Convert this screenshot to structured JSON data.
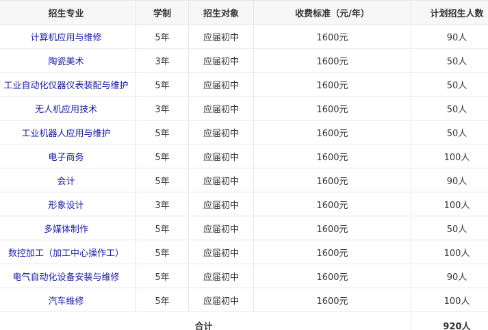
{
  "table": {
    "headers": {
      "major": "招生专业",
      "years": "学制",
      "target": "招生对象",
      "fee": "收费标准（元/年）",
      "plan": "计划招生人数"
    },
    "rows": [
      {
        "major": "计算机应用与维修",
        "years": "5年",
        "target": "应届初中",
        "fee": "1600元",
        "plan": "90人"
      },
      {
        "major": "陶瓷美术",
        "years": "3年",
        "target": "应届初中",
        "fee": "1600元",
        "plan": "50人"
      },
      {
        "major": "工业自动化仪器仪表装配与维护",
        "years": "5年",
        "target": "应届初中",
        "fee": "1600元",
        "plan": "50人"
      },
      {
        "major": "无人机应用技术",
        "years": "3年",
        "target": "应届初中",
        "fee": "1600元",
        "plan": "50人"
      },
      {
        "major": "工业机器人应用与维护",
        "years": "5年",
        "target": "应届初中",
        "fee": "1600元",
        "plan": "50人"
      },
      {
        "major": "电子商务",
        "years": "5年",
        "target": "应届初中",
        "fee": "1600元",
        "plan": "100人"
      },
      {
        "major": "会计",
        "years": "5年",
        "target": "应届初中",
        "fee": "1600元",
        "plan": "90人"
      },
      {
        "major": "形象设计",
        "years": "3年",
        "target": "应届初中",
        "fee": "1600元",
        "plan": "100人"
      },
      {
        "major": "多媒体制作",
        "years": "5年",
        "target": "应届初中",
        "fee": "1600元",
        "plan": "50人"
      },
      {
        "major": "数控加工（加工中心操作工）",
        "years": "5年",
        "target": "应届初中",
        "fee": "1600元",
        "plan": "100人"
      },
      {
        "major": "电气自动化设备安装与维修",
        "years": "5年",
        "target": "应届初中",
        "fee": "1600元",
        "plan": "90人"
      },
      {
        "major": "汽车维修",
        "years": "5年",
        "target": "应届初中",
        "fee": "1600元",
        "plan": "100人"
      }
    ],
    "footer": {
      "label": "合计",
      "total": "920人"
    }
  }
}
